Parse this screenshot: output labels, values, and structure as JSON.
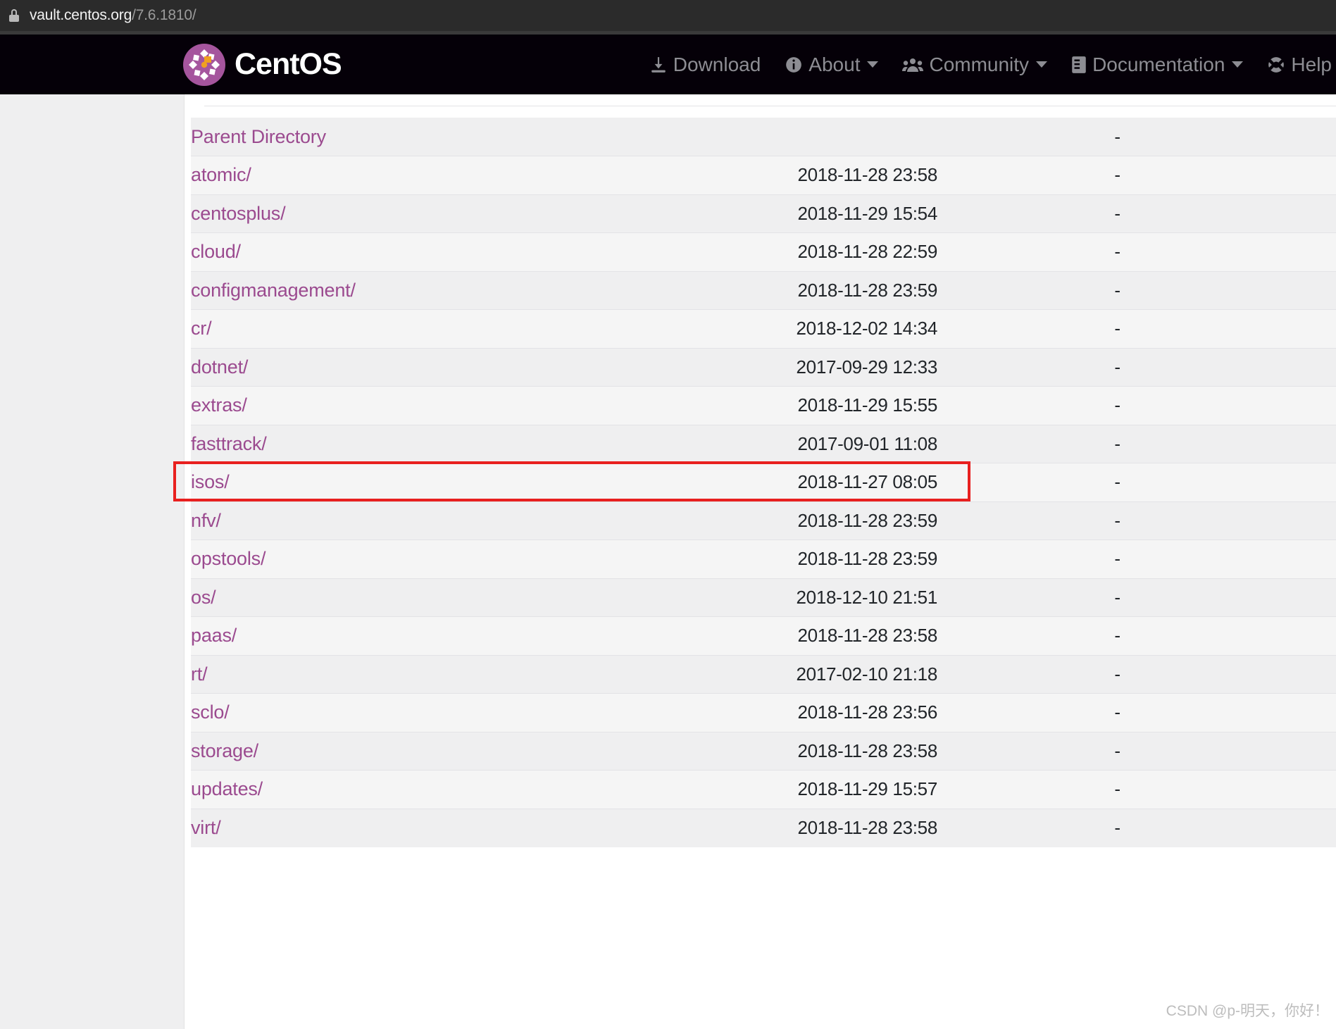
{
  "browser": {
    "lock_icon": "lock-icon",
    "url_host": "vault.centos.org",
    "url_path": "/7.6.1810/"
  },
  "topnav": {
    "brand": "CentOS",
    "brand_logo_icon": "centos-logo-icon",
    "items": [
      {
        "label": "Download",
        "icon": "download-icon",
        "caret": false
      },
      {
        "label": "About",
        "icon": "info-circle-icon",
        "caret": true
      },
      {
        "label": "Community",
        "icon": "users-icon",
        "caret": true
      },
      {
        "label": "Documentation",
        "icon": "book-icon",
        "caret": true
      },
      {
        "label": "Help",
        "icon": "life-ring-icon",
        "caret": true
      }
    ]
  },
  "listing": {
    "rows": [
      {
        "name": "Parent Directory",
        "date": "",
        "size": "-"
      },
      {
        "name": "atomic/",
        "date": "2018-11-28 23:58",
        "size": "-"
      },
      {
        "name": "centosplus/",
        "date": "2018-11-29 15:54",
        "size": "-"
      },
      {
        "name": "cloud/",
        "date": "2018-11-28 22:59",
        "size": "-"
      },
      {
        "name": "configmanagement/",
        "date": "2018-11-28 23:59",
        "size": "-"
      },
      {
        "name": "cr/",
        "date": "2018-12-02 14:34",
        "size": "-"
      },
      {
        "name": "dotnet/",
        "date": "2017-09-29 12:33",
        "size": "-"
      },
      {
        "name": "extras/",
        "date": "2018-11-29 15:55",
        "size": "-"
      },
      {
        "name": "fasttrack/",
        "date": "2017-09-01 11:08",
        "size": "-"
      },
      {
        "name": "isos/",
        "date": "2018-11-27 08:05",
        "size": "-"
      },
      {
        "name": "nfv/",
        "date": "2018-11-28 23:59",
        "size": "-"
      },
      {
        "name": "opstools/",
        "date": "2018-11-28 23:59",
        "size": "-"
      },
      {
        "name": "os/",
        "date": "2018-12-10 21:51",
        "size": "-"
      },
      {
        "name": "paas/",
        "date": "2018-11-28 23:58",
        "size": "-"
      },
      {
        "name": "rt/",
        "date": "2017-02-10 21:18",
        "size": "-"
      },
      {
        "name": "sclo/",
        "date": "2018-11-28 23:56",
        "size": "-"
      },
      {
        "name": "storage/",
        "date": "2018-11-28 23:58",
        "size": "-"
      },
      {
        "name": "updates/",
        "date": "2018-11-29 15:57",
        "size": "-"
      },
      {
        "name": "virt/",
        "date": "2018-11-28 23:58",
        "size": "-"
      }
    ]
  },
  "annotation": {
    "target_row": "isos/",
    "color": "#e8201f"
  },
  "watermark": {
    "text": "CSDN @p-明天，你好！"
  },
  "colors": {
    "link": "#9b4a8f",
    "nav_background": "#050008",
    "brand_purple": "#a5559d",
    "row_odd": "#efeff0",
    "row_even": "#f5f5f5",
    "annotation_red": "#e8201f"
  }
}
